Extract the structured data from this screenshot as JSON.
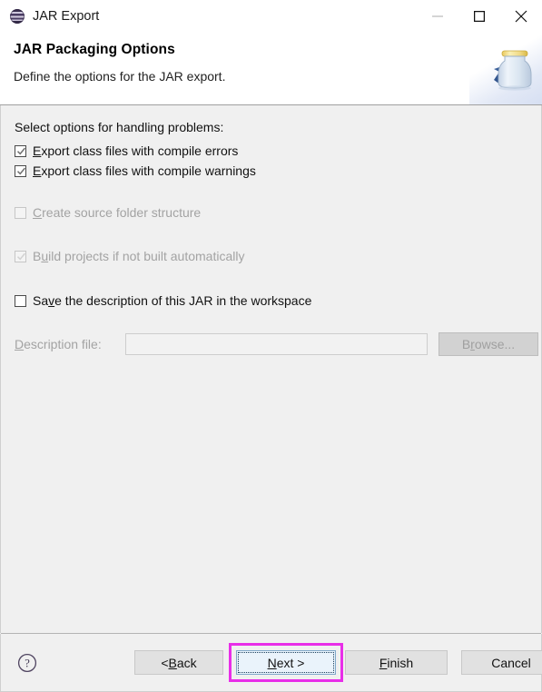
{
  "window": {
    "title": "JAR Export",
    "app_icon": "eclipse-sphere-icon",
    "controls": {
      "minimize": "minimize-icon",
      "maximize": "maximize-icon",
      "close": "close-icon"
    }
  },
  "header": {
    "title": "JAR Packaging Options",
    "description": "Define the options for the JAR export.",
    "graphic": "jar-export-banner-icon"
  },
  "body": {
    "section_label": "Select options for handling problems:",
    "options": [
      {
        "id": "export-with-errors",
        "label": "Export class files with compile errors",
        "mnemonic_prefix": "",
        "mnemonic": "E",
        "mnemonic_suffix": "xport class files with compile errors",
        "checked": true,
        "enabled": true
      },
      {
        "id": "export-with-warnings",
        "label": "Export class files with compile warnings",
        "mnemonic_prefix": "",
        "mnemonic": "E",
        "mnemonic_suffix": "xport class files with compile warnings",
        "checked": true,
        "enabled": true
      },
      {
        "id": "create-source-folder-structure",
        "label": "Create source folder structure",
        "mnemonic_prefix": "",
        "mnemonic": "C",
        "mnemonic_suffix": "reate source folder structure",
        "checked": false,
        "enabled": false
      },
      {
        "id": "build-projects-if-not-built",
        "label": "Build projects if not built automatically",
        "mnemonic_prefix": "B",
        "mnemonic": "u",
        "mnemonic_suffix": "ild projects if not built automatically",
        "checked": true,
        "enabled": false
      },
      {
        "id": "save-description-of-jar",
        "label": "Save the description of this JAR in the workspace",
        "mnemonic_prefix": "Sa",
        "mnemonic": "v",
        "mnemonic_suffix": "e the description of this JAR in the workspace",
        "checked": false,
        "enabled": true
      }
    ],
    "description_file": {
      "label_prefix": "",
      "label_mnemonic": "D",
      "label_suffix": "escription file:",
      "value": "",
      "placeholder": "",
      "enabled": false
    },
    "browse_button": {
      "prefix": "B",
      "mnemonic": "r",
      "suffix": "owse...",
      "enabled": false
    }
  },
  "footer": {
    "help_icon": "help-question-icon",
    "buttons": [
      {
        "id": "back",
        "prefix": "< ",
        "mnemonic": "B",
        "suffix": "ack",
        "focused": false,
        "highlighted": false
      },
      {
        "id": "next",
        "prefix": "",
        "mnemonic": "N",
        "suffix": "ext >",
        "focused": true,
        "highlighted": true
      },
      {
        "id": "finish",
        "prefix": "",
        "mnemonic": "F",
        "suffix": "inish",
        "focused": false,
        "highlighted": false
      },
      {
        "id": "cancel",
        "prefix": "Cancel",
        "mnemonic": "",
        "suffix": "",
        "focused": false,
        "highlighted": false
      }
    ]
  },
  "colors": {
    "highlight_annotation": "#e82ee8",
    "dialog_background": "#f0f0f0",
    "header_background": "#ffffff",
    "focus_button_background": "#eaf3fb",
    "disabled_text": "#a3a3a3"
  }
}
